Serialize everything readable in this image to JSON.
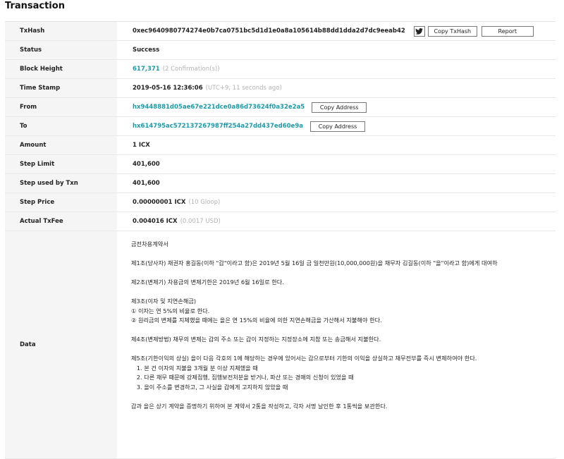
{
  "title": "Transaction",
  "txhash": {
    "label": "TxHash",
    "value": "0xec9640980774274e0b7ca0751bc5d1d1e0a8a105614b88dd1dda2d7dc9eeab42",
    "copy_label": "Copy TxHash",
    "report_label": "Report"
  },
  "status": {
    "label": "Status",
    "value": "Success"
  },
  "block_height": {
    "label": "Block Height",
    "value": "617,371",
    "confirmations": "(2 Confirmation(s))"
  },
  "timestamp": {
    "label": "Time Stamp",
    "value": "2019-05-16 12:36:06",
    "relative": "(UTC+9, 11 seconds ago)"
  },
  "from": {
    "label": "From",
    "address": "hx9448881d05ae67e221dce0a86d73624f0a32e2a5",
    "copy_label": "Copy Address"
  },
  "to": {
    "label": "To",
    "address": "hx614795ac572137267987ff254a27dd437ed60e9a",
    "copy_label": "Copy Address"
  },
  "amount": {
    "label": "Amount",
    "value": "1 ICX"
  },
  "step_limit": {
    "label": "Step Limit",
    "value": "401,600"
  },
  "step_used": {
    "label": "Step used by Txn",
    "value": "401,600"
  },
  "step_price": {
    "label": "Step Price",
    "value": "0.00000001",
    "unit": "ICX",
    "extra": "(10 Gloop)"
  },
  "actual_fee": {
    "label": "Actual TxFee",
    "value": "0.004016",
    "unit": "ICX",
    "extra": "(0.0017 USD)"
  },
  "data": {
    "label": "Data",
    "lines": [
      "금전차용계약서",
      "",
      "제1조(당사자) 채권자 홍길동(이하 \"갑\"이라고 함)은 2019년 5월 16일 금 일천만원(10,000,000원)을 채무자 김길동(이하 \"을\"이라고 함)에게 대여하",
      "",
      "제2조(변제기) 차용금의 변제기한은 2019년 6월 16일로 한다.",
      "",
      "제3조(이자 및 지연손해금)",
      "① 이자는 연 5%의 비율로 한다.",
      "② 원리금의 변제를 지체했을 때에는 을은 연 15%의 비율에 의한 지연손해금을 가산해서 지불해야 한다.",
      "",
      "제4조(변제방법) 채무의 변제는 갑의 주소 또는 갑이 지정하는 지정장소에 지참 또는 송금해서 지불한다.",
      "",
      "제5조(기한이익의 상실) 을이 다음 각호의 1에 해당하는 경우에 있어서는 갑으로부터 기한의 이익을 상실하고 채무전부를 즉시 변제하여야 한다.",
      "  1. 본 건 이자의 지불을 3개월 분 이상 지체했을 때",
      "  2. 다른 채무 때문에 강제집행, 집행보전처분을 받거나, 파산 또는 경매의 신청이 있었을 때",
      "  3. 을이 주소를 변경하고, 그 사실을 갑에게 고지하지 않았을 때",
      "",
      "갑과 을은 상기 계약을 증명하기 위하여 본 계약서 2통을 작성하고, 각자 서명 날인한 후 1통씩을 보관한다."
    ]
  }
}
